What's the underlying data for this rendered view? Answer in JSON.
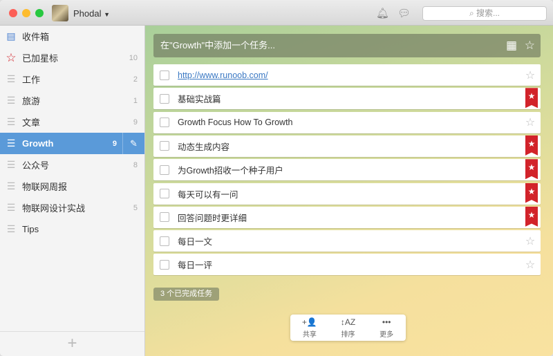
{
  "titlebar": {
    "user": "Phodal",
    "search_placeholder": "搜索..."
  },
  "sidebar": {
    "items": [
      {
        "label": "收件箱",
        "count": "",
        "icon": "inbox-icon"
      },
      {
        "label": "已加星标",
        "count": "10",
        "icon": "star-icon"
      },
      {
        "label": "工作",
        "count": "2",
        "icon": "list-icon"
      },
      {
        "label": "旅游",
        "count": "1",
        "icon": "list-icon"
      },
      {
        "label": "文章",
        "count": "9",
        "icon": "list-icon"
      },
      {
        "label": "Growth",
        "count": "9",
        "icon": "list-icon",
        "active": true
      },
      {
        "label": "公众号",
        "count": "8",
        "icon": "list-icon"
      },
      {
        "label": "物联网周报",
        "count": "",
        "icon": "list-icon"
      },
      {
        "label": "物联网设计实战",
        "count": "5",
        "icon": "list-icon"
      },
      {
        "label": "Tips",
        "count": "",
        "icon": "list-icon"
      }
    ],
    "add_label": "+"
  },
  "main": {
    "add_placeholder": "在\"Growth\"中添加一个任务...",
    "tasks": [
      {
        "title": "http://www.runoob.com/",
        "link": true,
        "starred": false
      },
      {
        "title": "基础实战篇",
        "starred": true
      },
      {
        "title": "Growth Focus How To Growth",
        "starred": false
      },
      {
        "title": "动态生成内容",
        "starred": true
      },
      {
        "title": "为Growth招收一个种子用户",
        "starred": true
      },
      {
        "title": "每天可以有一问",
        "starred": true
      },
      {
        "title": "回答问题时更详细",
        "starred": true
      },
      {
        "title": "每日一文",
        "starred": false
      },
      {
        "title": "每日一评",
        "starred": false
      }
    ],
    "completed_label": "3 个已完成任务",
    "toolbar": [
      {
        "label": "共享",
        "icon": "share-user-icon",
        "glyph": "+👤"
      },
      {
        "label": "排序",
        "icon": "sort-az-icon",
        "glyph": "↕AZ"
      },
      {
        "label": "更多",
        "icon": "more-icon",
        "glyph": "•••"
      }
    ]
  }
}
